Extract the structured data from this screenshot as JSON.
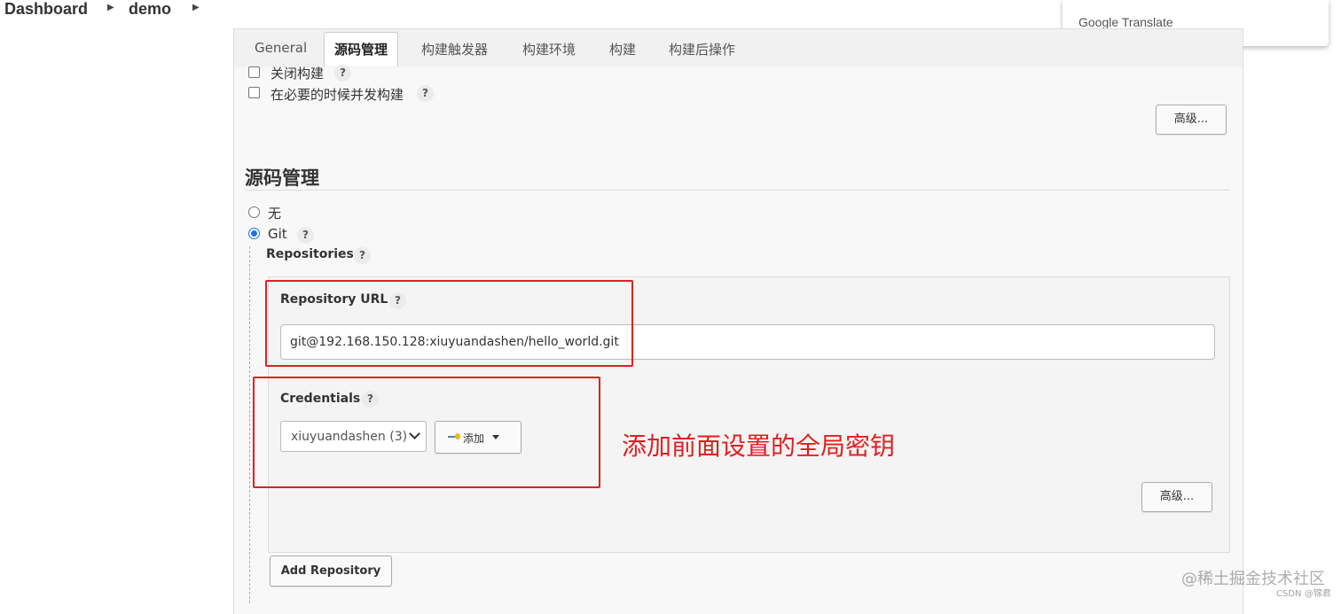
{
  "breadcrumb": {
    "dashboard": "Dashboard",
    "job": "demo"
  },
  "translate_popup": {
    "label": "Google Translate"
  },
  "tabs": [
    {
      "label": "General"
    },
    {
      "label": "源码管理"
    },
    {
      "label": "构建触发器"
    },
    {
      "label": "构建环境"
    },
    {
      "label": "构建"
    },
    {
      "label": "构建后操作"
    }
  ],
  "general": {
    "disable_build": "关闭构建",
    "concurrent_build": "在必要的时候并发构建",
    "advanced_button": "高级..."
  },
  "scm": {
    "title": "源码管理",
    "option_none": "无",
    "option_git": "Git",
    "selected": "Git",
    "repositories_label": "Repositories",
    "repository_url_label": "Repository URL",
    "repository_url_value": "git@192.168.150.128:xiuyuandashen/hello_world.git",
    "credentials_label": "Credentials",
    "credentials_selected": "xiuyuandashen (3)",
    "add_button": "添加",
    "advanced_button": "高级...",
    "add_repository_button": "Add Repository"
  },
  "help_glyph": "?",
  "annotation": {
    "text": "添加前面设置的全局密钥",
    "color": "#e02020"
  },
  "watermark": {
    "main": "@稀土掘金技术社区",
    "sub": "CSDN @锦君"
  },
  "colors": {
    "accent": "#1a73e8",
    "highlight_red": "#e02020",
    "panel_bg": "#f8f8f8"
  },
  "icons": [
    "caret-right-icon",
    "key-icon",
    "dropdown-caret-icon",
    "chevron-down-icon"
  ]
}
